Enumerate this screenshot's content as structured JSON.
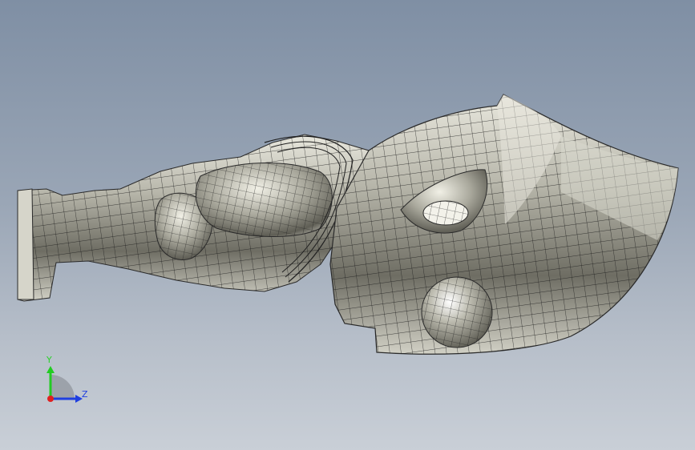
{
  "viewport": {
    "background_top": "#7f8fa4",
    "background_bottom": "#c9cfd7"
  },
  "model": {
    "surface_color": "#b9b8ac",
    "mesh_color": "#1a1a1a"
  },
  "triad": {
    "y_label": "Y",
    "z_label": "Z",
    "y_color": "#22cc22",
    "z_color": "#1f3fe0",
    "x_color": "#e02020"
  }
}
